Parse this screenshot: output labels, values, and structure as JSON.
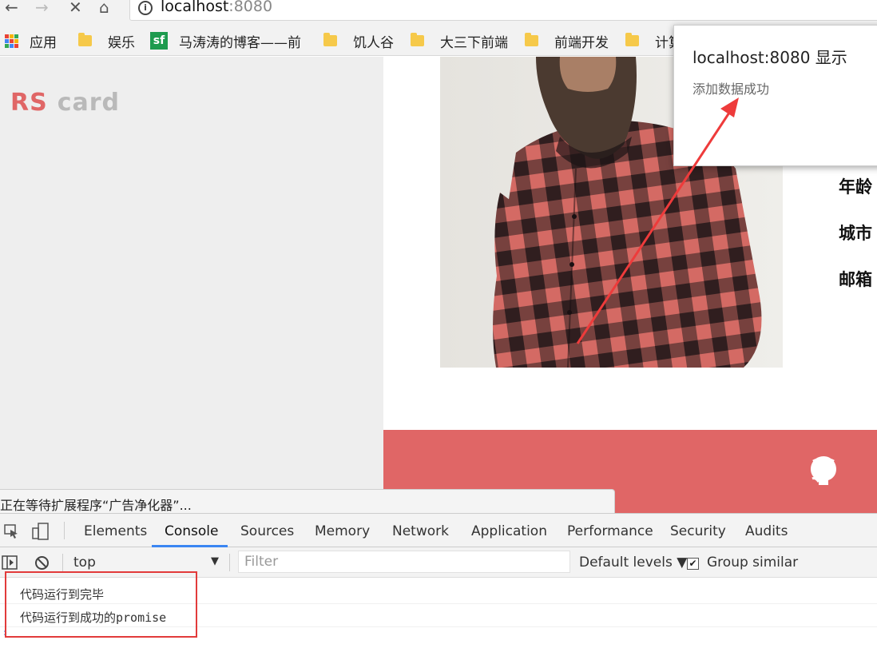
{
  "browser": {
    "nav": {
      "back": "←",
      "forward": "→",
      "stop": "✕",
      "home": "⌂"
    },
    "address": {
      "host": "localhost",
      "port": ":8080"
    }
  },
  "bookmarks": [
    {
      "label": "应用",
      "icon": "apps-grid-icon"
    },
    {
      "label": "娱乐",
      "icon": "folder-icon"
    },
    {
      "label": "马涛涛的博客——前",
      "icon": "sf-icon",
      "icon_text": "sf"
    },
    {
      "label": "饥人谷",
      "icon": "folder-icon"
    },
    {
      "label": "大三下前端",
      "icon": "folder-icon"
    },
    {
      "label": "前端开发",
      "icon": "folder-icon"
    },
    {
      "label": "计算",
      "icon": "folder-icon"
    }
  ],
  "page": {
    "logo_rs": "RS",
    "logo_card": "card",
    "labels": [
      "年龄",
      "城市",
      "邮箱"
    ],
    "colors": {
      "accent": "#e06666",
      "logo_gray": "#b9b9b9",
      "sidebar_bg": "#eeeeee"
    }
  },
  "alert": {
    "origin": "localhost:8080 显示",
    "message": "添加数据成功"
  },
  "status_bubble": "正在等待扩展程序“广告净化器”...",
  "devtools": {
    "tabs": [
      "Elements",
      "Console",
      "Sources",
      "Memory",
      "Network",
      "Application",
      "Performance",
      "Security",
      "Audits"
    ],
    "active_tab": "Console",
    "context": "top",
    "filter_placeholder": "Filter",
    "levels": "Default levels ▼",
    "group_similar": "Group similar",
    "group_similar_checked": true,
    "logs": [
      "代码运行到完毕",
      "代码运行到成功的promise"
    ],
    "prompt": "›"
  }
}
